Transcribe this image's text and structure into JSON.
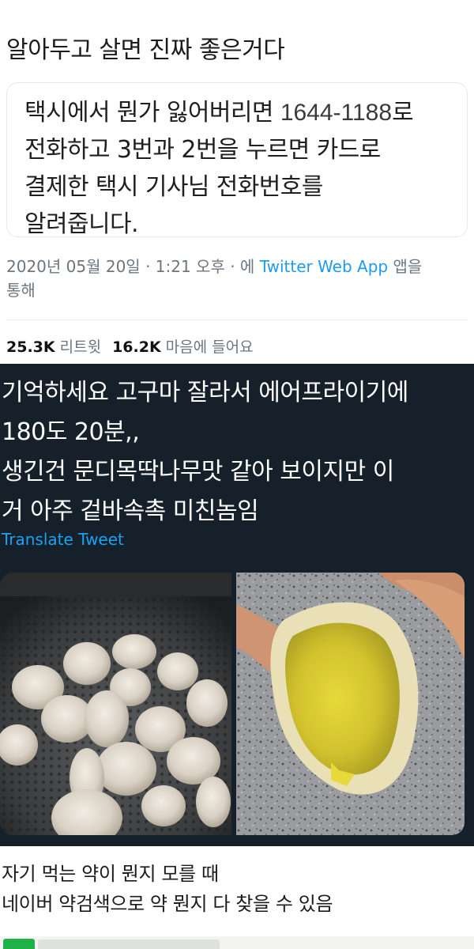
{
  "headline": "알아두고 살면 진짜 좋은거다",
  "quoted_tweet": {
    "line1_a": "택시에서 뭔가 잃어버리면 ",
    "line1_num": "1644-1188",
    "line1_b": "로",
    "line2": "전화하고 3번과 2번을 누르면 카드로",
    "line3": "결제한 택시 기사님 전화번호를",
    "line4": "알려줍니다."
  },
  "meta": {
    "timestamp": "2020년 05월 20일 · 1:21 오후 · 에 ",
    "client": "Twitter Web App",
    "suffix": " 앱을",
    "line2": "통해"
  },
  "stats": {
    "retweets_count": "25.3K",
    "retweets_label": "리트윗",
    "likes_count": "16.2K",
    "likes_label": "마음에 들어요"
  },
  "dark_tweet": {
    "text": "기억하세요 고구마 잘라서 에어프라이기에\n180도 20분,,\n생긴건 문디목딱나무맛 같아 보이지만 이\n거 아주 겉바속촉 미친놈임",
    "translate": "Translate Tweet",
    "images": [
      "air-fryer-sweet-potato-slices",
      "cut-sweet-potato-in-hand"
    ]
  },
  "bottom_post": {
    "text": "자기 먹는 약이 뭔지 모를 때\n네이버 약검색으로 약 뭔지 다 찾을 수 있음"
  },
  "colors": {
    "link": "#1d9bf0",
    "dark_bg": "#15202b",
    "muted": "#6b7680"
  }
}
